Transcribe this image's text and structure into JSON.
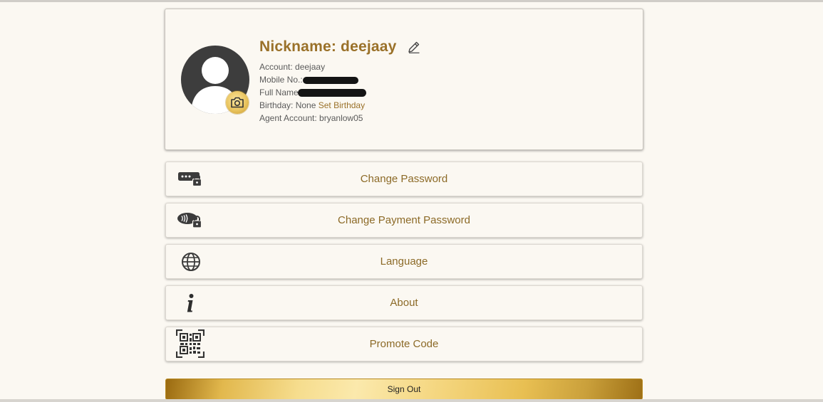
{
  "profile": {
    "nickname": "Nickname: deejaay",
    "account": "Account: deejaay",
    "mobile_label": "Mobile No.:",
    "full_name_label": "Full Name",
    "birthday_label": "Birthday: None",
    "birthday_link": "Set Birthday",
    "agent_account": "Agent Account: bryanlow05",
    "icons": {
      "avatar": "user-silhouette-icon",
      "camera": "camera-icon",
      "edit": "pencil-icon"
    }
  },
  "menu": [
    {
      "label": "Change Password",
      "icon": "password-lock-icon"
    },
    {
      "label": "Change Payment Password",
      "icon": "payment-lock-icon"
    },
    {
      "label": "Language",
      "icon": "globe-icon"
    },
    {
      "label": "About",
      "icon": "info-icon"
    },
    {
      "label": "Promote Code",
      "icon": "qr-code-icon"
    }
  ],
  "sign_out": {
    "label": "Sign Out"
  },
  "colors": {
    "background": "#fbf8f2",
    "accent_gold": "#9a7129",
    "text_gray": "#5b5b5b"
  }
}
